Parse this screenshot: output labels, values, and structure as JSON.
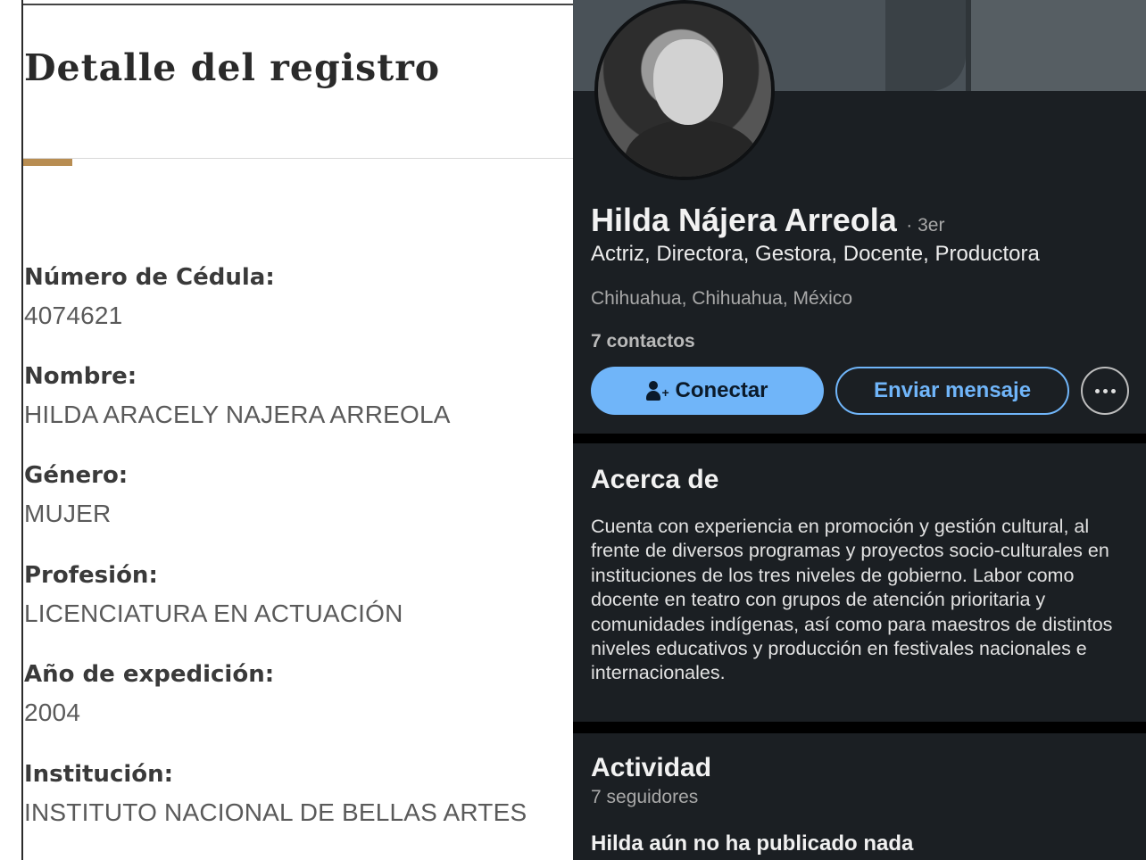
{
  "registry": {
    "title": "Detalle del registro",
    "fields": [
      {
        "label": "Número de Cédula:",
        "value": "4074621"
      },
      {
        "label": "Nombre:",
        "value": "HILDA ARACELY NAJERA ARREOLA"
      },
      {
        "label": "Género:",
        "value": "MUJER"
      },
      {
        "label": "Profesión:",
        "value": "LICENCIATURA EN ACTUACIÓN"
      },
      {
        "label": "Año de expedición:",
        "value": "2004"
      },
      {
        "label": "Institución:",
        "value": "INSTITUTO NACIONAL DE BELLAS ARTES"
      }
    ]
  },
  "profile": {
    "name": "Hilda Nájera Arreola",
    "degree": "· 3er",
    "headline": "Actriz, Directora, Gestora, Docente, Productora",
    "location": "Chihuahua, Chihuahua, México",
    "contacts": "7 contactos",
    "connect_label": "Conectar",
    "message_label": "Enviar mensaje",
    "accent_color": "#70b5f9"
  },
  "about": {
    "title": "Acerca de",
    "text": "Cuenta con experiencia en promoción y gestión cultural, al frente de diversos programas y proyectos socio-culturales en instituciones de los tres niveles de gobierno. Labor como docente en teatro con grupos de atención prioritaria y comunidades indígenas, así como para maestros de distintos niveles educativos y producción en festivales nacionales e internacionales."
  },
  "activity": {
    "title": "Actividad",
    "followers": "7 seguidores",
    "no_posts": "Hilda aún no ha publicado nada"
  }
}
